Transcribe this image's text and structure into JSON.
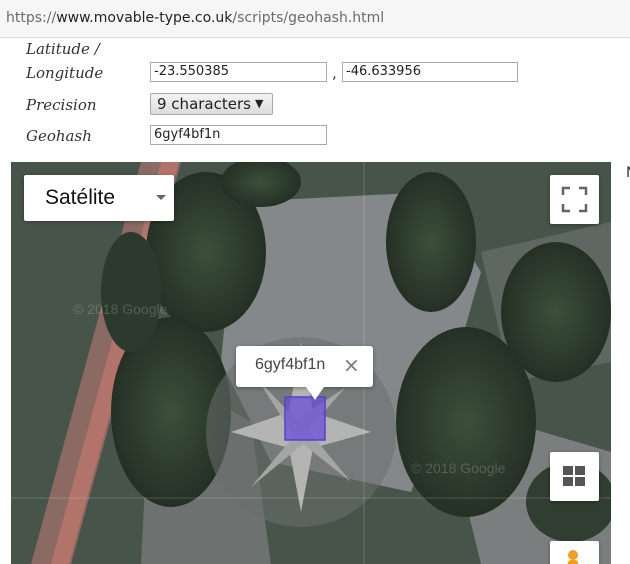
{
  "browser": {
    "url_prefix": "https://",
    "url_domain": "www.movable-type.co.uk",
    "url_path": "/scripts/geohash.html"
  },
  "form": {
    "latlon_label_line1": "Latitude /",
    "latlon_label_line2": "Longitude",
    "latitude_value": "-23.550385",
    "separator": ",",
    "longitude_value": "-46.633956",
    "precision_label": "Precision",
    "precision_value": "9 characters",
    "geohash_label": "Geohash",
    "geohash_value": "6gyf4bf1n"
  },
  "map": {
    "map_type_label": "Satélite",
    "info_window_text": "6gyf4bf1n",
    "close_symbol": "×",
    "watermark": "© 2018 Google",
    "icons": [
      "fullscreen-icon",
      "map-grid-icon",
      "pegman-icon",
      "close-icon",
      "dropdown-caret-icon"
    ],
    "cell_color": "#6b4fd8"
  },
  "right_edge_text": "N"
}
